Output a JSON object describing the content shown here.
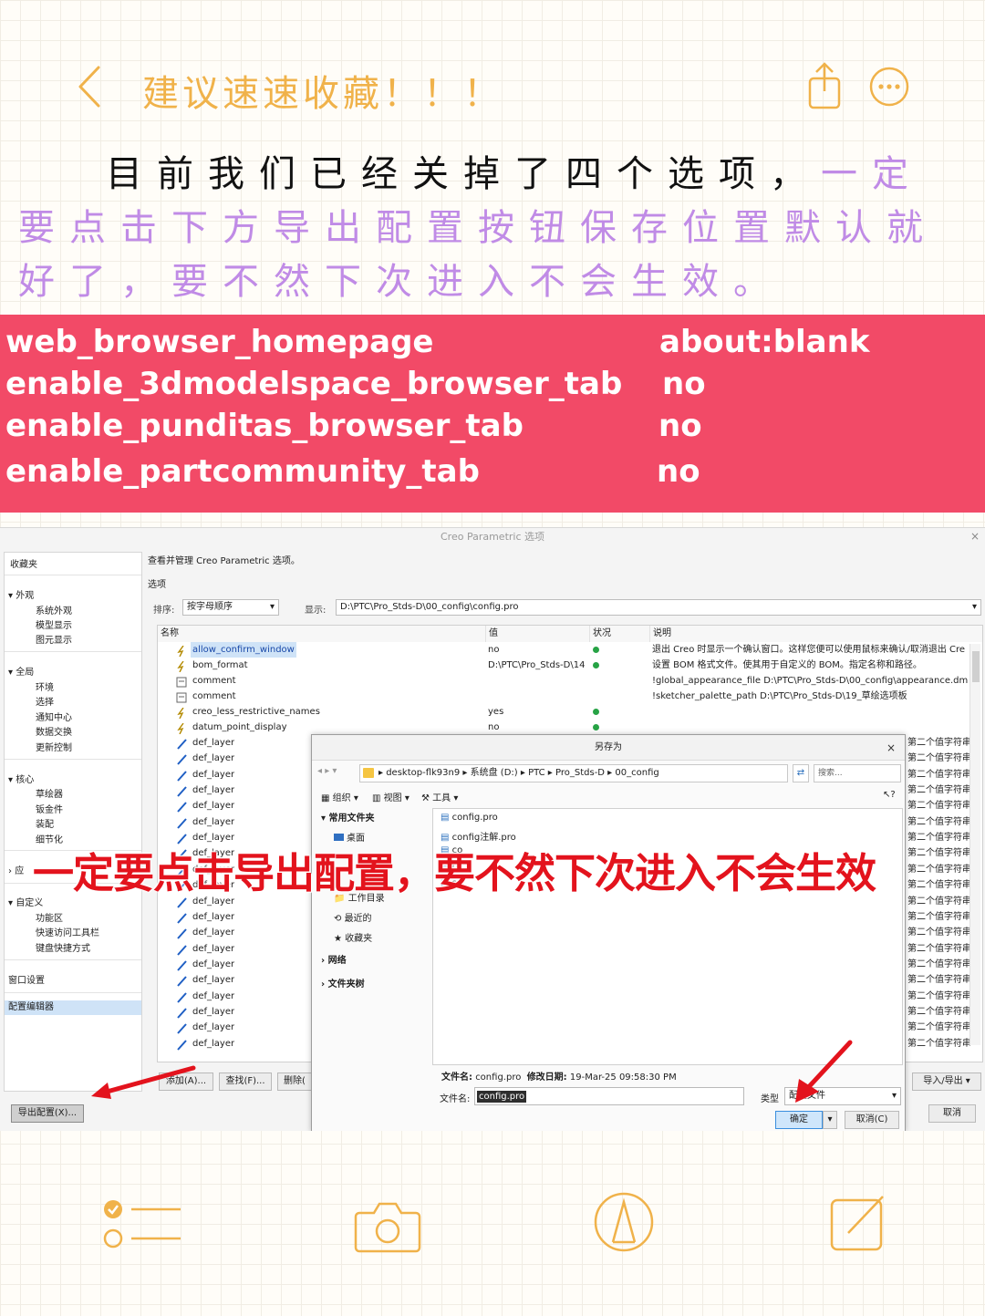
{
  "topbar": {
    "title": "建议速速收藏！！！",
    "back_icon": "chevron-left-icon",
    "share_icon": "share-icon",
    "more_icon": "more-icon",
    "accent_color": "#f0b24a"
  },
  "intro": {
    "black_text": "目前我们已经关掉了四个选项，",
    "highlight_text": "一定要点击下方导出配置按钮保存位置默认就好了，要不然下次进入不会生效。",
    "highlight_color": "#c08be6"
  },
  "config_band": {
    "background": "#f24a67",
    "rows": [
      {
        "key": "web_browser_homepage",
        "value": "about:blank"
      },
      {
        "key": "enable_3dmodelspace_browser_tab",
        "value": "no"
      },
      {
        "key": "enable_punditas_browser_tab",
        "value": "no"
      },
      {
        "key": "enable_partcommunity_tab",
        "value": "no"
      }
    ]
  },
  "screenshot": {
    "window_title": "Creo Parametric 选项",
    "close": "×",
    "left_nav": {
      "favorites": "收藏夹",
      "groups": [
        {
          "title": "外观",
          "items": [
            "系统外观",
            "模型显示",
            "图元显示"
          ]
        },
        {
          "title": "全局",
          "items": [
            "环境",
            "选择",
            "通知中心",
            "数据交换",
            "更新控制"
          ]
        },
        {
          "title": "核心",
          "items": [
            "草绘器",
            "钣金件",
            "装配",
            "细节化"
          ]
        },
        {
          "title": "应",
          "items": []
        },
        {
          "title": "自定义",
          "items": [
            "功能区",
            "快速访问工具栏",
            "键盘快捷方式"
          ]
        }
      ],
      "window_settings": "窗口设置",
      "config_editor": "配置编辑器"
    },
    "header": "查看并管理 Creo Parametric 选项。",
    "options_label": "选项",
    "sort_label": "排序:",
    "sort_value": "按字母顺序",
    "show_label": "显示:",
    "show_value": "D:\\PTC\\Pro_Stds-D\\00_config\\config.pro",
    "columns": {
      "name": "名称",
      "value": "值",
      "status": "状况",
      "desc": "说明"
    },
    "rows": [
      {
        "name": "allow_confirm_window",
        "value": "no",
        "dot": true,
        "desc": "退出 Creo 时显示一个确认窗口。这样您便可以使用鼠标来确认/取消退出 Cre"
      },
      {
        "name": "bom_format",
        "value": "D:\\PTC\\Pro_Stds-D\\14",
        "dot": true,
        "desc": "设置 BOM 格式文件。使其用于自定义的 BOM。指定名称和路径。"
      },
      {
        "name": "comment",
        "value": "",
        "dot": false,
        "desc": "!global_appearance_file D:\\PTC\\Pro_Stds-D\\00_config\\appearance.dm"
      },
      {
        "name": "comment",
        "value": "",
        "dot": false,
        "desc": "!sketcher_palette_path D:\\PTC\\Pro_Stds-D\\19_草绘选项板"
      },
      {
        "name": "creo_less_restrictive_names",
        "value": "yes",
        "dot": true,
        "desc": ""
      },
      {
        "name": "datum_point_display",
        "value": "no",
        "dot": true,
        "desc": ""
      }
    ],
    "layer_rows": [
      "def_layer",
      "def_layer",
      "def_layer",
      "def_layer",
      "def_layer",
      "def_layer",
      "def_layer",
      "def_layer",
      "def_layer",
      "def_layer",
      "def_layer",
      "def_layer",
      "def_layer",
      "def_layer",
      "def_layer",
      "def_layer",
      "def_layer",
      "def_layer",
      "def_layer",
      "def_layer"
    ],
    "right_desc": "第二个值字符串",
    "buttons": {
      "add": "添加(A)...",
      "find": "查找(F)...",
      "delete": "删除(",
      "export": "导出配置(X)...",
      "import_export": "导入/导出",
      "cancel": "取消"
    },
    "save_as": {
      "title": "另存为",
      "breadcrumb": [
        "desktop-flk93n9",
        "系统盘 (D:)",
        "PTC",
        "Pro_Stds-D",
        "00_config"
      ],
      "search_placeholder": "搜索...",
      "tools": [
        "组织",
        "视图",
        "工具"
      ],
      "nav": {
        "common": "常用文件夹",
        "desktop": "桌面",
        "workdir": "工作目录",
        "recent": "最近的",
        "favorites": "收藏夹",
        "network": "网络",
        "folder_tree": "文件夹树"
      },
      "files": [
        "config.pro",
        "config注解.pro",
        "co",
        "m",
        "sc"
      ],
      "meta_label": "文件名:",
      "meta_file": "config.pro",
      "meta_date_label": "修改日期:",
      "meta_date": "19-Mar-25 09:58:30 PM",
      "filename_label": "文件名:",
      "filename_value": "config.pro",
      "type_label": "类型",
      "type_value": "配置文件",
      "ok": "确定",
      "cancel": "取消(C)"
    },
    "overlay_text": "一定要点击导出配置，要不然下次进入不会生效",
    "overlay_color": "#e3131d"
  },
  "bottombar": {
    "icons": [
      "checklist-icon",
      "camera-icon",
      "pen-icon",
      "edit-icon"
    ],
    "color": "#f0b24a"
  }
}
